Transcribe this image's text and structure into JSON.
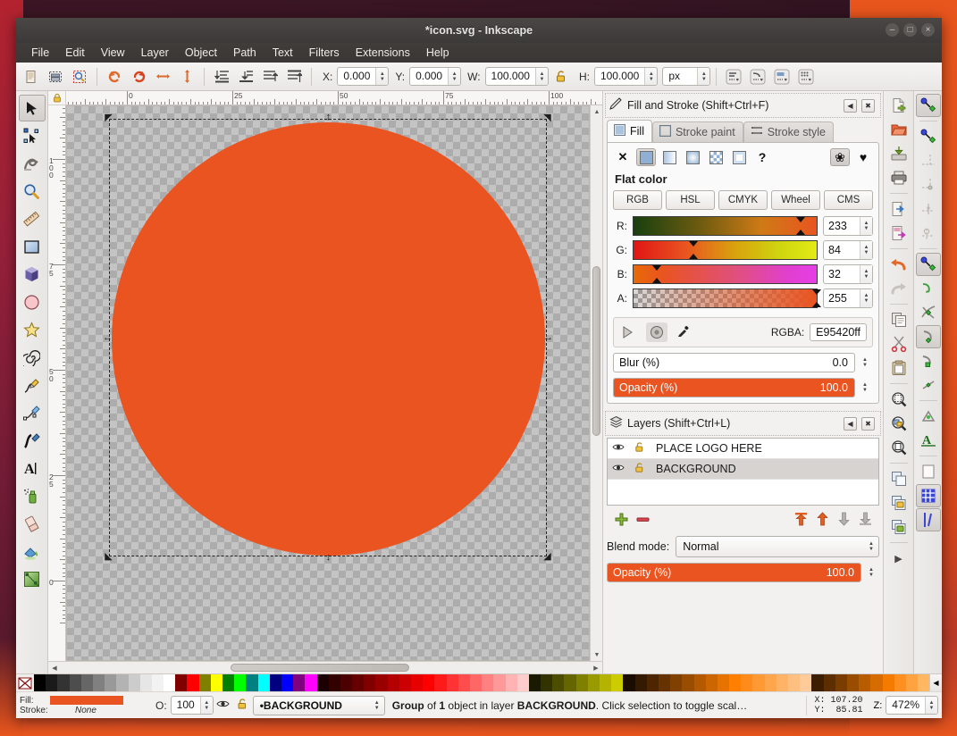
{
  "window": {
    "title": "*icon.svg - Inkscape",
    "buttons": {
      "minimize": "–",
      "maximize": "□",
      "close": "×"
    }
  },
  "menubar": {
    "items": [
      "File",
      "Edit",
      "View",
      "Layer",
      "Object",
      "Path",
      "Text",
      "Filters",
      "Extensions",
      "Help"
    ]
  },
  "commandbar": {
    "icons": [
      "new-document-icon",
      "select-all-icon",
      "select-in-all-layers-icon",
      "rotate-ccw-icon",
      "rotate-cw-icon",
      "flip-horizontal-icon",
      "flip-vertical-icon",
      "lower-to-bottom-icon",
      "lower-icon",
      "raise-icon",
      "raise-to-top-icon"
    ],
    "x_label": "X:",
    "x_value": "0.000",
    "y_label": "Y:",
    "y_value": "0.000",
    "w_label": "W:",
    "w_value": "100.000",
    "lock_icon": "lock-open-icon",
    "h_label": "H:",
    "h_value": "100.000",
    "units": "px",
    "affect_icons": [
      "scale-stroke-icon",
      "scale-corners-icon",
      "transform-gradients-icon",
      "transform-patterns-icon"
    ]
  },
  "toolbox": {
    "tools": [
      {
        "name": "selector-tool",
        "glyph": "↖",
        "active": true
      },
      {
        "name": "node-tool",
        "glyph": "✧",
        "active": false
      },
      {
        "name": "tweak-tool",
        "glyph": "〜",
        "active": false
      },
      {
        "name": "zoom-tool",
        "glyph": "⚲",
        "active": false
      },
      {
        "name": "measure-tool",
        "glyph": "╱",
        "active": false
      },
      {
        "name": "rectangle-tool",
        "glyph": "■",
        "active": false
      },
      {
        "name": "3dbox-tool",
        "glyph": "⬟",
        "active": false
      },
      {
        "name": "ellipse-tool",
        "glyph": "●",
        "active": false
      },
      {
        "name": "star-tool",
        "glyph": "★",
        "active": false
      },
      {
        "name": "spiral-tool",
        "glyph": "◌",
        "active": false
      },
      {
        "name": "pencil-tool",
        "glyph": "✎",
        "active": false
      },
      {
        "name": "bezier-tool",
        "glyph": "✐",
        "active": false
      },
      {
        "name": "calligraphy-tool",
        "glyph": "✒",
        "active": false
      },
      {
        "name": "text-tool",
        "glyph": "A",
        "active": false
      },
      {
        "name": "spray-tool",
        "glyph": "⚘",
        "active": false
      },
      {
        "name": "eraser-tool",
        "glyph": "▱",
        "active": false
      },
      {
        "name": "paint-bucket-tool",
        "glyph": "☖",
        "active": false
      },
      {
        "name": "gradient-tool",
        "glyph": "◨",
        "active": false
      }
    ]
  },
  "canvas": {
    "hruler_labels": [
      "0",
      "25",
      "50",
      "75",
      "100"
    ],
    "vruler_labels": [
      "100",
      "75",
      "50",
      "25",
      "0"
    ],
    "shape": {
      "name": "orange-circle",
      "fill": "#e95420"
    },
    "selection": "selection-bounding-box"
  },
  "fill_and_stroke": {
    "panel_title": "Fill and Stroke (Shift+Ctrl+F)",
    "collapse_icon": "collapse-icon",
    "close_icon": "close-icon",
    "tabs": [
      {
        "label": "Fill",
        "icon": "fill-swatch-icon",
        "active": true
      },
      {
        "label": "Stroke paint",
        "icon": "stroke-paint-icon",
        "active": false
      },
      {
        "label": "Stroke style",
        "icon": "stroke-style-icon",
        "active": false
      }
    ],
    "fill_types": [
      {
        "name": "no-paint-button",
        "glyph": "✕",
        "selected": false
      },
      {
        "name": "flat-color-button",
        "glyph": "",
        "selected": true
      },
      {
        "name": "linear-gradient-button",
        "glyph": "",
        "selected": false
      },
      {
        "name": "radial-gradient-button",
        "glyph": "",
        "selected": false
      },
      {
        "name": "pattern-button",
        "glyph": "",
        "selected": false
      },
      {
        "name": "swatch-button",
        "glyph": "",
        "selected": false
      },
      {
        "name": "unset-paint-button",
        "glyph": "?",
        "selected": false
      }
    ],
    "fillrule_buttons": [
      {
        "name": "even-odd-fillrule-button",
        "glyph": "❀",
        "selected": true
      },
      {
        "name": "nonzero-fillrule-button",
        "glyph": "♥",
        "selected": false
      }
    ],
    "flat_color_label": "Flat color",
    "color_modes": [
      "RGB",
      "HSL",
      "CMYK",
      "Wheel",
      "CMS"
    ],
    "active_color_mode": "RGB",
    "channels": [
      {
        "label": "R:",
        "value": "233",
        "pos_pct": 91.4
      },
      {
        "label": "G:",
        "value": "84",
        "pos_pct": 32.9
      },
      {
        "label": "B:",
        "value": "32",
        "pos_pct": 12.5
      },
      {
        "label": "A:",
        "value": "255",
        "pos_pct": 100.0
      }
    ],
    "picker_buttons": [
      {
        "name": "last-used-color-button",
        "glyph": "◸",
        "active": false
      },
      {
        "name": "color-wheel-button",
        "glyph": "◉",
        "active": true
      },
      {
        "name": "eyedropper-button",
        "glyph": "✐",
        "active": false
      }
    ],
    "rgba_label": "RGBA:",
    "rgba_value": "E95420ff",
    "blur": {
      "label": "Blur (%)",
      "value": "0.0",
      "percent": 0
    },
    "opacity": {
      "label": "Opacity (%)",
      "value": "100.0",
      "percent": 100
    }
  },
  "layers": {
    "panel_title": "Layers (Shift+Ctrl+L)",
    "collapse_icon": "collapse-icon",
    "close_icon": "close-icon",
    "rows": [
      {
        "name": "PLACE LOGO HERE",
        "visible_icon": "eye-icon",
        "lock_icon": "lock-open-icon",
        "selected": false
      },
      {
        "name": "BACKGROUND",
        "visible_icon": "eye-icon",
        "lock_icon": "lock-open-icon",
        "selected": true
      }
    ],
    "buttons": [
      {
        "name": "add-layer-button",
        "glyph": "✚",
        "color": "#7aa832"
      },
      {
        "name": "delete-layer-button",
        "glyph": "➖",
        "color": "#d43f3f"
      },
      {
        "name": "raise-to-top-button",
        "glyph": "⤒",
        "color": "#e35f20"
      },
      {
        "name": "raise-layer-button",
        "glyph": "↑",
        "color": "#e35f20"
      },
      {
        "name": "lower-layer-button",
        "glyph": "↓",
        "color": "#a8a5a1"
      },
      {
        "name": "lower-to-bottom-button",
        "glyph": "⤓",
        "color": "#a8a5a1"
      }
    ],
    "blend_label": "Blend mode:",
    "blend_value": "Normal",
    "opacity": {
      "label": "Opacity (%)",
      "value": "100.0",
      "percent": 100
    }
  },
  "right_commands": {
    "icons": [
      {
        "name": "new-file-icon",
        "glyph": "📄",
        "sep_after": false
      },
      {
        "name": "open-file-icon",
        "glyph": "📁",
        "sep_after": false
      },
      {
        "name": "save-file-icon",
        "glyph": "💾",
        "sep_after": false
      },
      {
        "name": "print-icon",
        "glyph": "⎙",
        "sep_after": true
      },
      {
        "name": "import-icon",
        "glyph": "➡",
        "sep_after": false
      },
      {
        "name": "export-icon",
        "glyph": "⮕",
        "sep_after": true
      },
      {
        "name": "undo-icon",
        "glyph": "↶",
        "sep_after": false
      },
      {
        "name": "redo-icon",
        "glyph": "↷",
        "sep_after": true
      },
      {
        "name": "copy-icon",
        "glyph": "⧉",
        "sep_after": false
      },
      {
        "name": "cut-icon",
        "glyph": "✂",
        "sep_after": false
      },
      {
        "name": "paste-icon",
        "glyph": "📋",
        "sep_after": true
      },
      {
        "name": "zoom-selection-icon",
        "glyph": "⚲",
        "sep_after": false
      },
      {
        "name": "zoom-drawing-icon",
        "glyph": "⚲",
        "sep_after": false
      },
      {
        "name": "zoom-page-icon",
        "glyph": "⚲",
        "sep_after": true
      },
      {
        "name": "duplicate-icon",
        "glyph": "⧉",
        "sep_after": false
      },
      {
        "name": "group-icon",
        "glyph": "⊞",
        "sep_after": false
      },
      {
        "name": "ungroup-icon",
        "glyph": "⊟",
        "sep_after": true
      },
      {
        "name": "overflow-arrow-icon",
        "glyph": "▸",
        "sep_after": false
      }
    ]
  },
  "snap_bar": {
    "icons": [
      {
        "name": "enable-snapping-icon",
        "glyph": "↘",
        "active": true,
        "sep_after": true
      },
      {
        "name": "snap-bounding-box-icon",
        "glyph": "↘",
        "active": false,
        "sep_after": false
      },
      {
        "name": "snap-bbox-edges-icon",
        "glyph": "⌷",
        "active": false,
        "sep_after": false
      },
      {
        "name": "snap-bbox-corners-icon",
        "glyph": "⊹",
        "active": false,
        "sep_after": false
      },
      {
        "name": "snap-bbox-edge-midpoints-icon",
        "glyph": "⌶",
        "active": false,
        "sep_after": false
      },
      {
        "name": "snap-bbox-centers-icon",
        "glyph": "⊙",
        "active": false,
        "sep_after": true
      },
      {
        "name": "snap-nodes-icon",
        "glyph": "↘",
        "active": true,
        "sep_after": false
      },
      {
        "name": "snap-paths-icon",
        "glyph": "⤵",
        "active": false,
        "sep_after": false
      },
      {
        "name": "snap-path-intersections-icon",
        "glyph": "✕",
        "active": false,
        "sep_after": false
      },
      {
        "name": "snap-cusp-nodes-icon",
        "glyph": "⤴",
        "active": true,
        "sep_after": false
      },
      {
        "name": "snap-smooth-nodes-icon",
        "glyph": "⤶",
        "active": false,
        "sep_after": false
      },
      {
        "name": "snap-midpoints-icon",
        "glyph": "◇",
        "active": false,
        "sep_after": true
      },
      {
        "name": "snap-others-icon",
        "glyph": "✲",
        "active": false,
        "sep_after": false
      },
      {
        "name": "snap-text-baseline-icon",
        "glyph": "A",
        "active": false,
        "sep_after": true
      },
      {
        "name": "snap-page-border-icon",
        "glyph": "▫",
        "active": false,
        "sep_after": false
      },
      {
        "name": "snap-grid-icon",
        "glyph": "▦",
        "active": true,
        "sep_after": false
      },
      {
        "name": "snap-guides-icon",
        "glyph": "│",
        "active": true,
        "sep_after": false
      }
    ]
  },
  "palette": {
    "none_icon": "no-color-icon",
    "colors": [
      "#000000",
      "#1a1a1a",
      "#333333",
      "#4d4d4d",
      "#666666",
      "#808080",
      "#999999",
      "#b3b3b3",
      "#cccccc",
      "#e6e6e6",
      "#f2f2f2",
      "#ffffff",
      "#800000",
      "#ff0000",
      "#808000",
      "#ffff00",
      "#008000",
      "#00ff00",
      "#008080",
      "#00ffff",
      "#000080",
      "#0000ff",
      "#800080",
      "#ff00ff",
      "#1a0000",
      "#330000",
      "#4d0000",
      "#660000",
      "#800000",
      "#990000",
      "#b30000",
      "#cc0000",
      "#e60000",
      "#ff0000",
      "#ff1a1a",
      "#ff3333",
      "#ff4d4d",
      "#ff6666",
      "#ff8080",
      "#ff9999",
      "#ffb3b3",
      "#ffcccc",
      "#1a1a00",
      "#333300",
      "#4d4d00",
      "#666600",
      "#808000",
      "#999900",
      "#b3b300",
      "#cccc00",
      "#1a0d00",
      "#331a00",
      "#4d2600",
      "#663300",
      "#804000",
      "#994d00",
      "#b35900",
      "#cc6600",
      "#e67300",
      "#ff8000",
      "#ff8c1a",
      "#ff9933",
      "#ffa64d",
      "#ffb366",
      "#ffbf80",
      "#ffcc99",
      "#3d1f00",
      "#5c2e00",
      "#7a3d00",
      "#994d00",
      "#b85c00",
      "#d66b00",
      "#f57a00",
      "#ff8f1f",
      "#ffa340",
      "#ffb761"
    ],
    "overflow_icon": "palette-overflow-icon"
  },
  "statusbar": {
    "fill_label": "Fill:",
    "fill_color": "#e95420",
    "stroke_label": "Stroke:",
    "stroke_value": "None",
    "opacity_label": "O:",
    "opacity_value": "100",
    "visibility_icon": "eye-icon",
    "lock_icon": "lock-open-icon",
    "layer_indicator": "•BACKGROUND",
    "message_parts": [
      {
        "text": "Group",
        "bold": true
      },
      {
        "text": " of ",
        "bold": false
      },
      {
        "text": "1",
        "bold": true
      },
      {
        "text": " object in layer ",
        "bold": false
      },
      {
        "text": "BACKGROUND",
        "bold": true
      },
      {
        "text": ". Click selection to toggle scal…",
        "bold": false
      }
    ],
    "x_label": "X:",
    "x_value": "107.20",
    "y_label": "Y:",
    "y_value": "85.81",
    "z_label": "Z:",
    "zoom_value": "472%"
  }
}
